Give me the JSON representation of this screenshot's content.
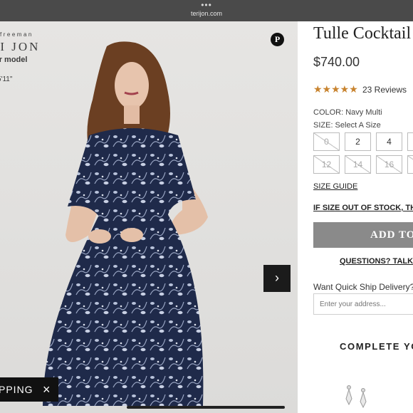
{
  "browser": {
    "dots": "•••",
    "url": "terijon.com"
  },
  "image_overlay": {
    "brand_small": "freeman",
    "brand": "RI JON",
    "model_label": "ur model",
    "model_height": "5'11\"",
    "pinterest_icon": "pinterest-icon",
    "next_icon": "chevron-right-icon"
  },
  "promo": {
    "text": "PPING",
    "close_icon": "close-icon"
  },
  "product": {
    "title": "Tulle Cocktail",
    "price": "$740.00",
    "rating": 5,
    "rating_glyphs": "★★★★★",
    "reviews": "23 Reviews",
    "color_label": "COLOR: Navy Multi",
    "size_label": "SIZE: Select A Size",
    "sizes": [
      {
        "label": "0",
        "available": false
      },
      {
        "label": "2",
        "available": true
      },
      {
        "label": "4",
        "available": true
      },
      {
        "label": "",
        "available": true
      },
      {
        "label": "12",
        "available": false
      },
      {
        "label": "14",
        "available": false
      },
      {
        "label": "16",
        "available": false
      },
      {
        "label": "",
        "available": false
      }
    ],
    "size_guide": "SIZE GUIDE",
    "out_of_stock_link": "IF SIZE OUT OF STOCK, THE",
    "add_button": "ADD TO",
    "questions_link": "QUESTIONS? TALK T",
    "quick_ship_label": "Want Quick Ship Delivery?",
    "address_placeholder": "Enter your address...",
    "complete_heading": "COMPLETE YO"
  },
  "colors": {
    "accent_star": "#c8832e",
    "dress_navy": "#1f2a4a",
    "button_gray": "#8a8a8a"
  }
}
